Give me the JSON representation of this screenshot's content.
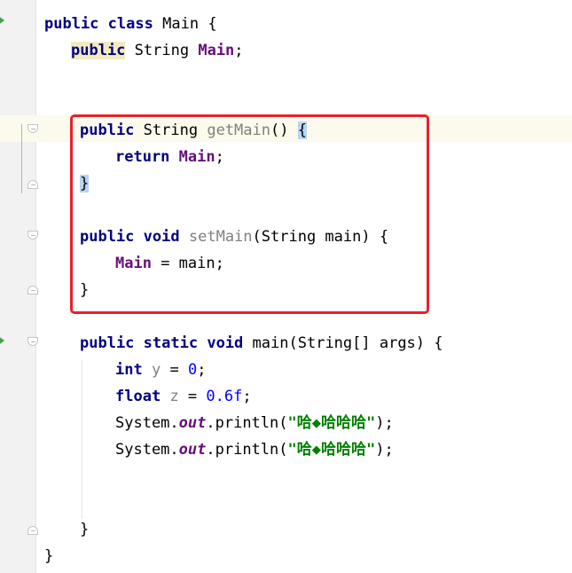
{
  "editor": {
    "lines": {
      "class_decl": {
        "kw1": "public",
        "kw2": "class",
        "name": "Main",
        "brace": "{"
      },
      "field_decl": {
        "kw": "public",
        "type": "String",
        "name": "Main",
        "semi": ";"
      },
      "getter_sig": {
        "kw": "public",
        "type": "String",
        "name": "getMain",
        "params": "()",
        "brace": "{"
      },
      "getter_ret": {
        "kw": "return",
        "field": "Main",
        "semi": ";"
      },
      "getter_end": {
        "brace": "}"
      },
      "setter_sig": {
        "kw1": "public",
        "kw2": "void",
        "name": "setMain",
        "params": "(String main)",
        "brace": "{"
      },
      "setter_body": {
        "field": "Main",
        "rest": " = main;"
      },
      "setter_end": {
        "brace": "}"
      },
      "main_sig": {
        "kw1": "public",
        "kw2": "static",
        "kw3": "void",
        "name": "main",
        "params": "(String[] args)",
        "brace": "{"
      },
      "int_decl": {
        "kw": "int",
        "var": "y",
        "eq": " = ",
        "val": "0",
        "semi": ";"
      },
      "float_decl": {
        "kw": "float",
        "var": "z",
        "eq": " = ",
        "val": "0.6f",
        "semi": ";"
      },
      "print1": {
        "obj": "System.",
        "field": "out",
        "call": ".println(",
        "str": "\"哈◆哈哈哈\"",
        "end": ");"
      },
      "print2": {
        "obj": "System.",
        "field": "out",
        "call": ".println(",
        "str": "\"哈◆哈哈哈\"",
        "end": ");"
      },
      "main_end": {
        "brace": "}"
      },
      "class_end": {
        "brace": "}"
      }
    },
    "colors": {
      "keyword": "#000080",
      "field": "#660e7a",
      "number": "#0000ff",
      "string": "#008000",
      "unused": "#808080",
      "selection_box": "#e8212b"
    }
  }
}
